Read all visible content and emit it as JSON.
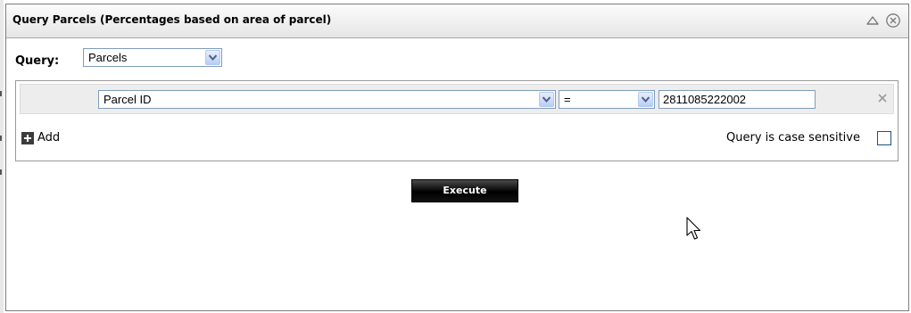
{
  "panel": {
    "title": "Query Parcels (Percentages based on area of parcel)",
    "icons": [
      "collapse-icon",
      "close-icon"
    ]
  },
  "query": {
    "label": "Query:",
    "selected": "Parcels"
  },
  "criteria": {
    "field": "Parcel ID",
    "operator": "=",
    "value": "2811085222002",
    "remove_icon": "close-x-icon"
  },
  "add": {
    "label": "Add",
    "icon": "plus-icon"
  },
  "case_sensitive": {
    "label": "Query is case sensitive",
    "checked": false
  },
  "execute": {
    "label": "Execute"
  },
  "colors": {
    "border": "#7f9db9",
    "dropdown_arrow": "#4d6185",
    "button_bg": "#000000"
  }
}
